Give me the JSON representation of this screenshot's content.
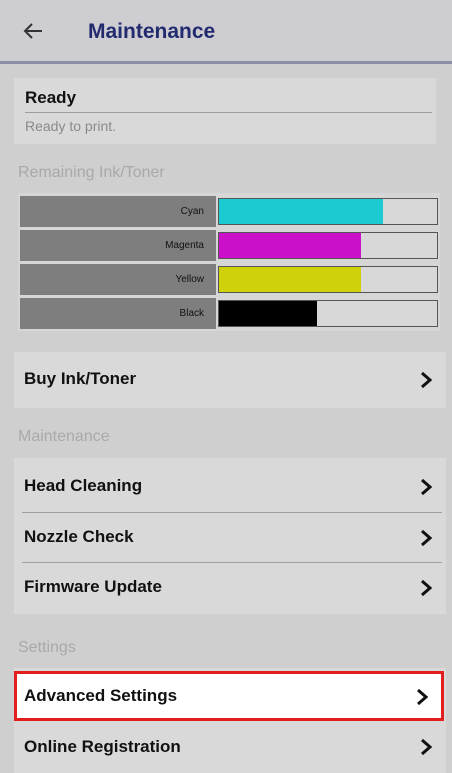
{
  "appbar": {
    "title": "Maintenance",
    "back_icon": "arrow-left-icon"
  },
  "status": {
    "title": "Ready",
    "subtitle": "Ready to print."
  },
  "ink": {
    "section_label": "Remaining Ink/Toner",
    "items": [
      {
        "name": "Cyan",
        "level": 0.75,
        "color": "#1ccbd1"
      },
      {
        "name": "Magenta",
        "level": 0.65,
        "color": "#cc10c9"
      },
      {
        "name": "Yellow",
        "level": 0.65,
        "color": "#cfd10a"
      },
      {
        "name": "Black",
        "level": 0.45,
        "color": "#000000"
      }
    ]
  },
  "buy": {
    "label": "Buy Ink/Toner"
  },
  "maintenance": {
    "section_label": "Maintenance",
    "items": [
      {
        "label": "Head Cleaning"
      },
      {
        "label": "Nozzle Check"
      },
      {
        "label": "Firmware Update"
      }
    ]
  },
  "settings": {
    "section_label": "Settings",
    "items": [
      {
        "label": "Advanced Settings"
      },
      {
        "label": "Online Registration"
      }
    ]
  },
  "colors": {
    "highlight": "#e41d1d",
    "title": "#232b6f"
  }
}
